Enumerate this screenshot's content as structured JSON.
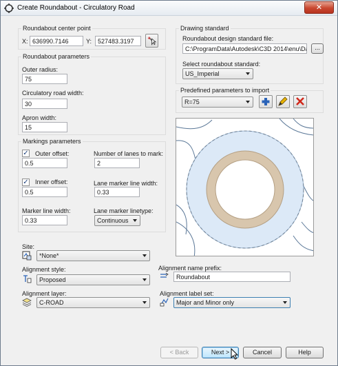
{
  "window": {
    "title": "Create Roundabout - Circulatory Road",
    "close_glyph": "✕"
  },
  "center_point": {
    "group_title": "Roundabout center point",
    "x_label": "X:",
    "x_value": "636990.7146",
    "y_label": "Y:",
    "y_value": "527483.3197"
  },
  "roundabout_params": {
    "group_title": "Roundabout parameters",
    "outer_radius_label": "Outer radius:",
    "outer_radius_value": "75",
    "circ_width_label": "Circulatory road width:",
    "circ_width_value": "30",
    "apron_width_label": "Apron width:",
    "apron_width_value": "15"
  },
  "markings": {
    "group_title": "Markings parameters",
    "outer_offset_label": "Outer offset:",
    "outer_offset_checked": true,
    "outer_offset_value": "0.5",
    "inner_offset_label": "Inner offset:",
    "inner_offset_checked": true,
    "inner_offset_value": "0.5",
    "marker_width_label": "Marker line width:",
    "marker_width_value": "0.33",
    "lanes_label": "Number of lanes to mark:",
    "lanes_value": "2",
    "lane_width_label": "Lane marker line width:",
    "lane_width_value": "0.33",
    "lane_linetype_label": "Lane marker linetype:",
    "lane_linetype_value": "Continuous"
  },
  "drawing_standard": {
    "group_title": "Drawing standard",
    "file_label": "Roundabout design standard file:",
    "file_value": "C:\\ProgramData\\Autodesk\\C3D 2014\\enu\\Data\\",
    "browse_label": "...",
    "select_label": "Select roundabout standard:",
    "select_value": "US_Imperial"
  },
  "predefined": {
    "group_title": "Predefined parameters to import",
    "select_value": "R=75"
  },
  "bottom": {
    "site_label": "Site:",
    "site_value": "*None*",
    "style_label": "Alignment style:",
    "style_value": "Proposed",
    "layer_label": "Alignment layer:",
    "layer_value": "C-ROAD",
    "prefix_label": "Alignment name prefix:",
    "prefix_value": "Roundabout",
    "labelset_label": "Alignment label set:",
    "labelset_value": "Major and Minor only"
  },
  "buttons": {
    "back": "< Back",
    "next": "Next >",
    "cancel": "Cancel",
    "help": "Help"
  },
  "icons": [
    "roundabout-app-icon",
    "pick-point-icon",
    "add-icon",
    "edit-icon",
    "delete-icon",
    "site-icon",
    "alignment-style-icon",
    "layer-icon",
    "prefix-icon",
    "label-set-icon"
  ],
  "colors": {
    "apron": "#d8c6ad",
    "circulatory": "#dce9f7",
    "delete": "#d0281b",
    "add": "#2a63b8"
  }
}
